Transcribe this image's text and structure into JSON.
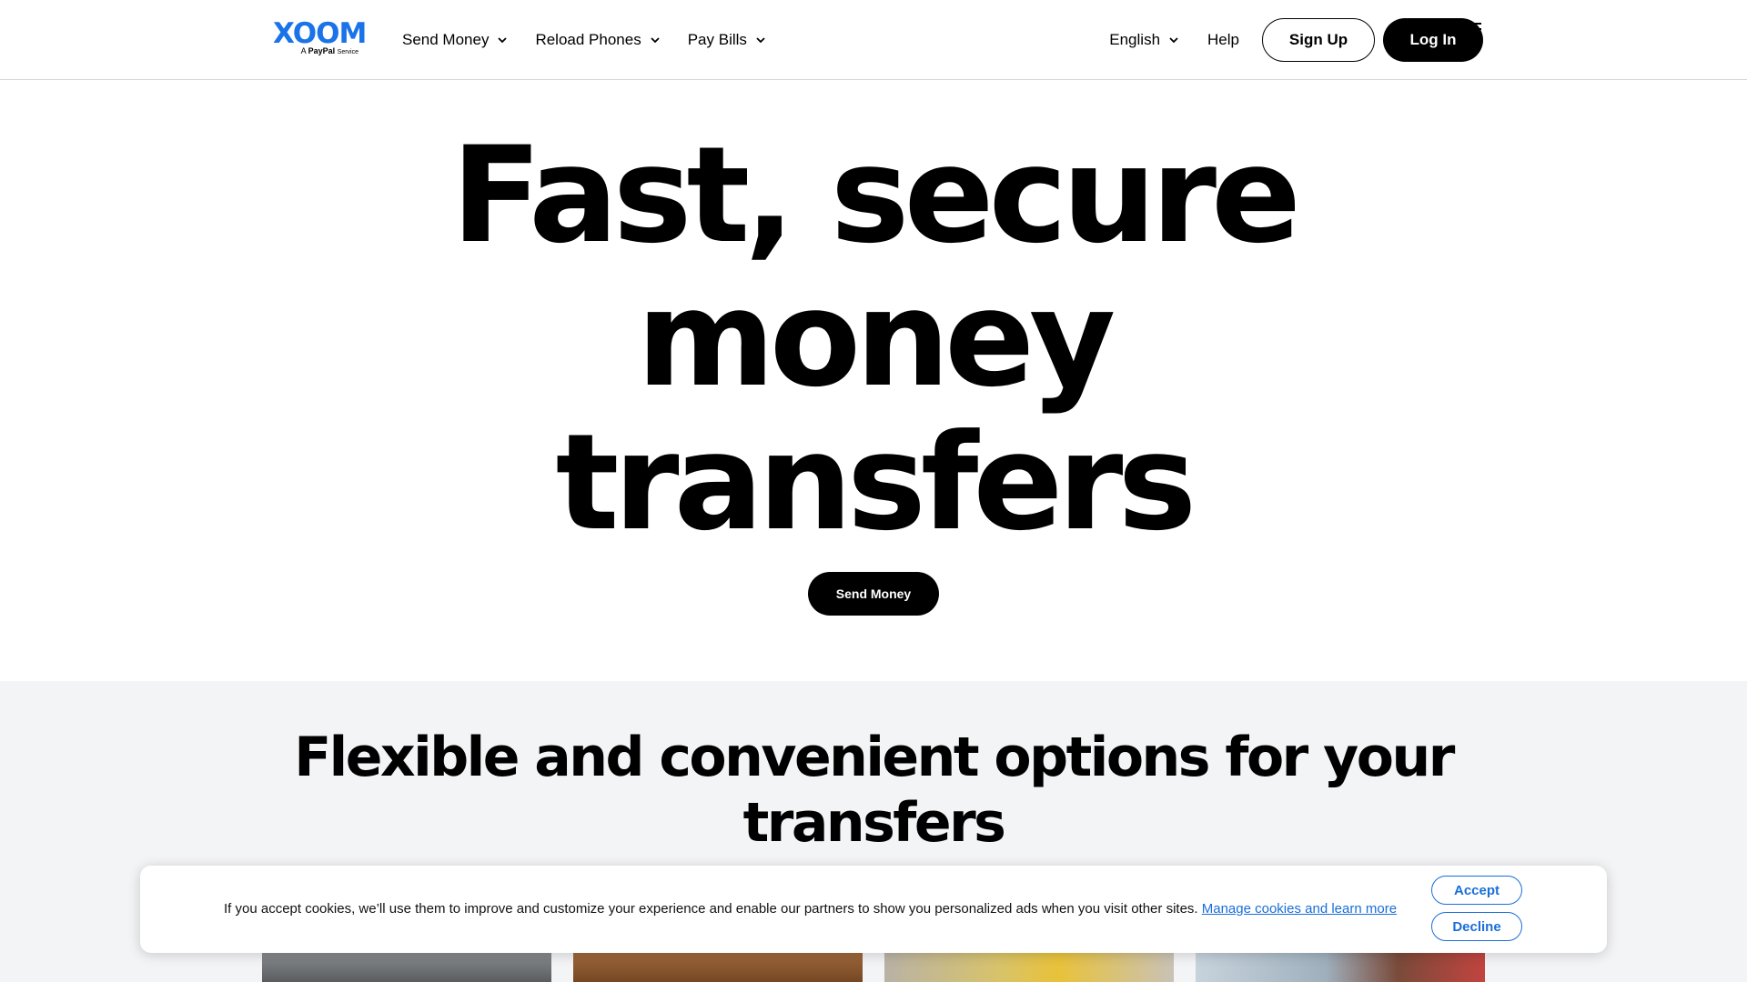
{
  "header": {
    "logo": {
      "word": "XOOM",
      "tagline_prefix": "A",
      "tagline_brand": "PayPal",
      "tagline_suffix": "Service"
    },
    "nav": [
      {
        "label": "Send Money"
      },
      {
        "label": "Reload Phones"
      },
      {
        "label": "Pay Bills"
      }
    ],
    "language": "English",
    "help": "Help",
    "signup": "Sign Up",
    "login": "Log In",
    "menu_icon": "hamburger-menu-icon"
  },
  "hero": {
    "title_lines": [
      "Fast, secure",
      "money",
      "transfers"
    ],
    "cta": "Send Money"
  },
  "options": {
    "title_lines": [
      "Flexible and convenient options for your",
      "transfers"
    ]
  },
  "cookie": {
    "text": "If you accept cookies, we’ll use them to improve and customize your experience and enable our partners to show you personalized ads when you visit other sites.",
    "link": "Manage cookies and learn more",
    "accept": "Accept",
    "decline": "Decline"
  },
  "colors": {
    "brand_blue": "#1a73e8",
    "link_blue": "#1a6ed8",
    "section_bg": "#f3f4f6",
    "black": "#000000"
  }
}
